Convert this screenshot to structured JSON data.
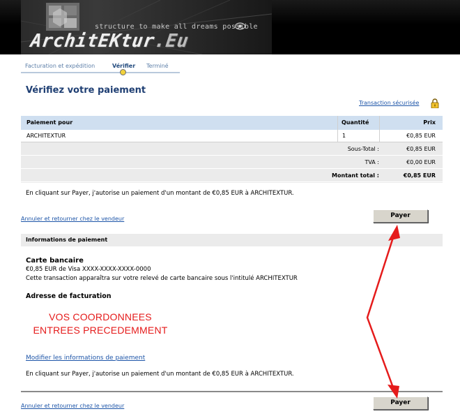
{
  "banner": {
    "tagline": "structure to make all dreams possible",
    "logo_main": "ArchitEKtur",
    "logo_tld": ".Eu"
  },
  "steps": {
    "items": [
      "Facturation et expédition",
      "Vérifier",
      "Terminé"
    ],
    "active_index": 1
  },
  "page": {
    "title": "Vérifiez votre paiement",
    "secure_link": "Transaction sécurisée"
  },
  "order": {
    "headers": {
      "item": "Paiement pour",
      "qty": "Quantité",
      "price": "Prix"
    },
    "rows": [
      {
        "item": "ARCHITEXTUR",
        "qty": "1",
        "price": "€0,85 EUR"
      }
    ],
    "subtotal_label": "Sous-Total :",
    "subtotal": "€0,85 EUR",
    "tax_label": "TVA :",
    "tax": "€0,00 EUR",
    "total_label": "Montant total :",
    "total": "€0,85 EUR"
  },
  "authorization_text": "En cliquant sur Payer, j'autorise un paiement d'un montant de €0,85 EUR à ARCHITEXTUR.",
  "cancel_link": "Annuler et retourner chez le vendeur",
  "pay_button": "Payer",
  "payment_info": {
    "header": "Informations de paiement",
    "card_title": "Carte bancaire",
    "card_line": "€0,85 EUR de Visa XXXX-XXXX-XXXX-0000",
    "statement_line": "Cette transaction apparaîtra sur votre relevé de carte bancaire sous l'intitulé ARCHITEXTUR",
    "billing_title": "Adresse de facturation",
    "annotation_line1": "VOS COORDONNEES",
    "annotation_line2": "ENTREES PRECEDEMMENT",
    "modify_link": "Modifier les informations de paiement"
  },
  "colors": {
    "accent": "#1f3f73",
    "link": "#1d55a8",
    "table_header": "#cfdff0",
    "annotation": "#e51b1b",
    "step_marker": "#f2d23c"
  },
  "icons": [
    "eye-icon",
    "cube-logo-icon",
    "lock-icon",
    "red-arrow-icon"
  ]
}
